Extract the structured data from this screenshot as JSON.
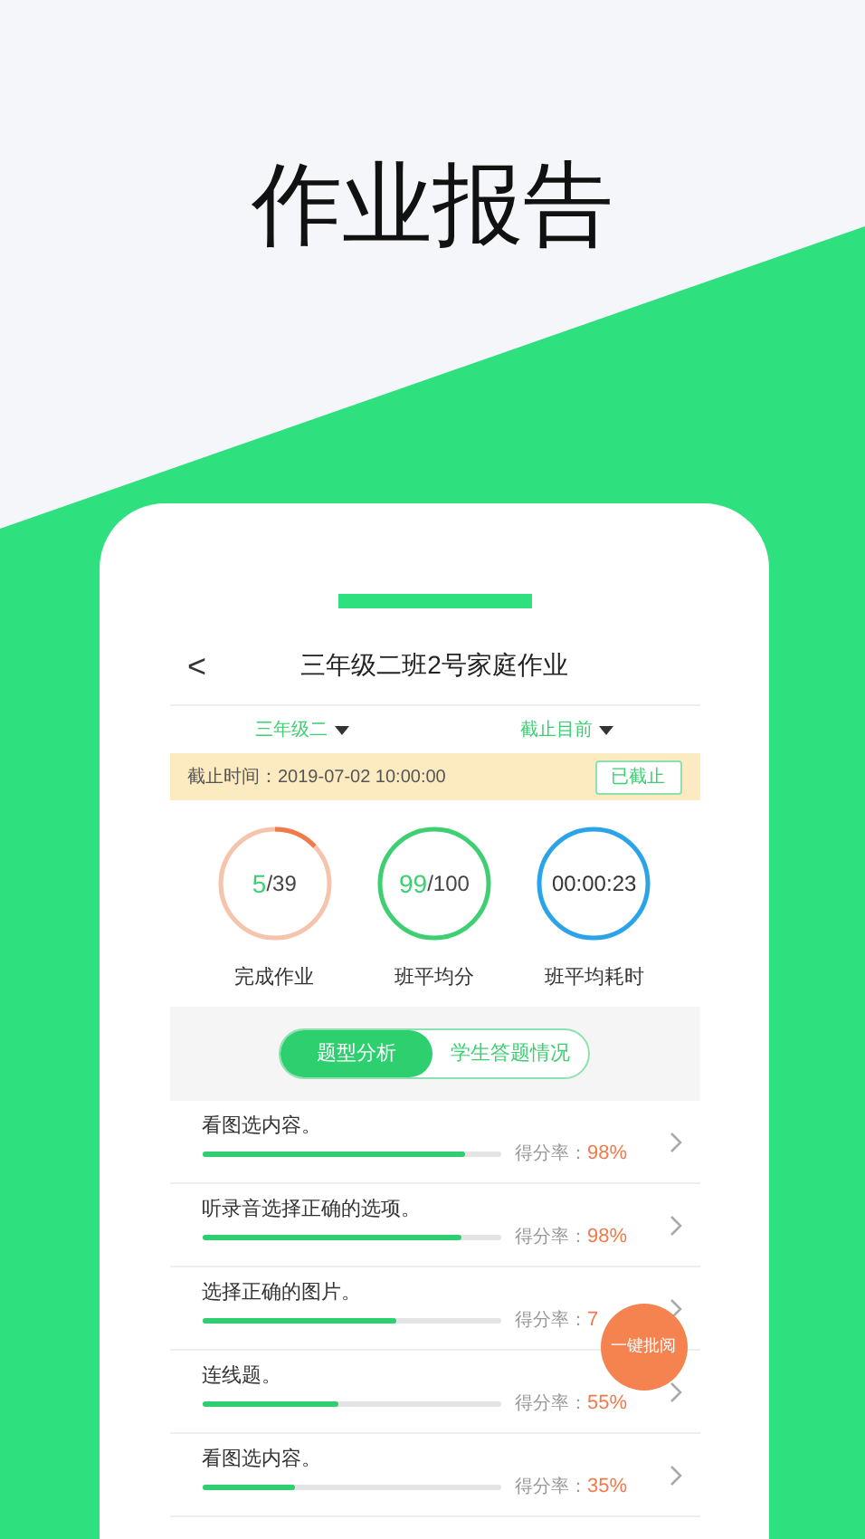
{
  "headline": "作业报告",
  "nav": {
    "back": "<",
    "title": "三年级二班2号家庭作业"
  },
  "filters": [
    {
      "label": "三年级二"
    },
    {
      "label": "截止目前"
    }
  ],
  "deadline": {
    "text": "截止时间：2019-07-02 10:00:00",
    "status": "已截止"
  },
  "stats": [
    {
      "value": "5",
      "total": "/39",
      "label": "完成作业",
      "kind": "partial",
      "color": "#f07a4a"
    },
    {
      "value": "99",
      "total": "/100",
      "label": "班平均分",
      "kind": "full",
      "color": "#3ecf72"
    },
    {
      "value": "00:00:23",
      "label": "班平均耗时",
      "kind": "full",
      "color": "#2aa3e8"
    }
  ],
  "tabs": [
    {
      "label": "题型分析",
      "selected": true
    },
    {
      "label": "学生答题情况",
      "selected": false
    }
  ],
  "questions": [
    {
      "title": "看图选内容。",
      "score_label": "得分率：",
      "score": "98%",
      "level": 0.88
    },
    {
      "title": "听录音选择正确的选项。",
      "score_label": "得分率：",
      "score": "98%",
      "level": 0.87
    },
    {
      "title": "选择正确的图片。",
      "score_label": "得分率：",
      "score": "7",
      "level": 0.65
    },
    {
      "title": "连线题。",
      "score_label": "得分率：",
      "score": "55%",
      "level": 0.46
    },
    {
      "title": "看图选内容。",
      "score_label": "得分率：",
      "score": "35%",
      "level": 0.31
    }
  ],
  "fab": {
    "label": "一键批阅"
  }
}
